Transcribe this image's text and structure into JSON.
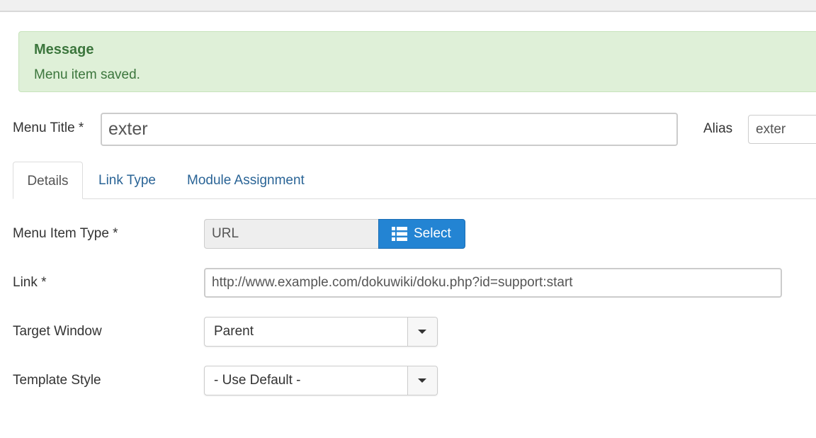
{
  "message": {
    "heading": "Message",
    "text": "Menu item saved."
  },
  "menu_title": {
    "label": "Menu Title *",
    "value": "exter"
  },
  "alias": {
    "label": "Alias",
    "value": "exter"
  },
  "tabs": [
    {
      "label": "Details",
      "active": true
    },
    {
      "label": "Link Type",
      "active": false
    },
    {
      "label": "Module Assignment",
      "active": false
    }
  ],
  "fields": {
    "menu_item_type": {
      "label": "Menu Item Type *",
      "value": "URL",
      "button_label": "Select",
      "button_icon": "list-icon"
    },
    "link": {
      "label": "Link *",
      "value": "http://www.example.com/dokuwiki/doku.php?id=support:start"
    },
    "target_window": {
      "label": "Target Window",
      "value": "Parent"
    },
    "template_style": {
      "label": "Template Style",
      "value": "- Use Default -"
    }
  },
  "colors": {
    "alert_bg": "#dff0d8",
    "alert_text": "#3c763d",
    "primary_button": "#2384d3",
    "tab_link": "#2a6496"
  }
}
